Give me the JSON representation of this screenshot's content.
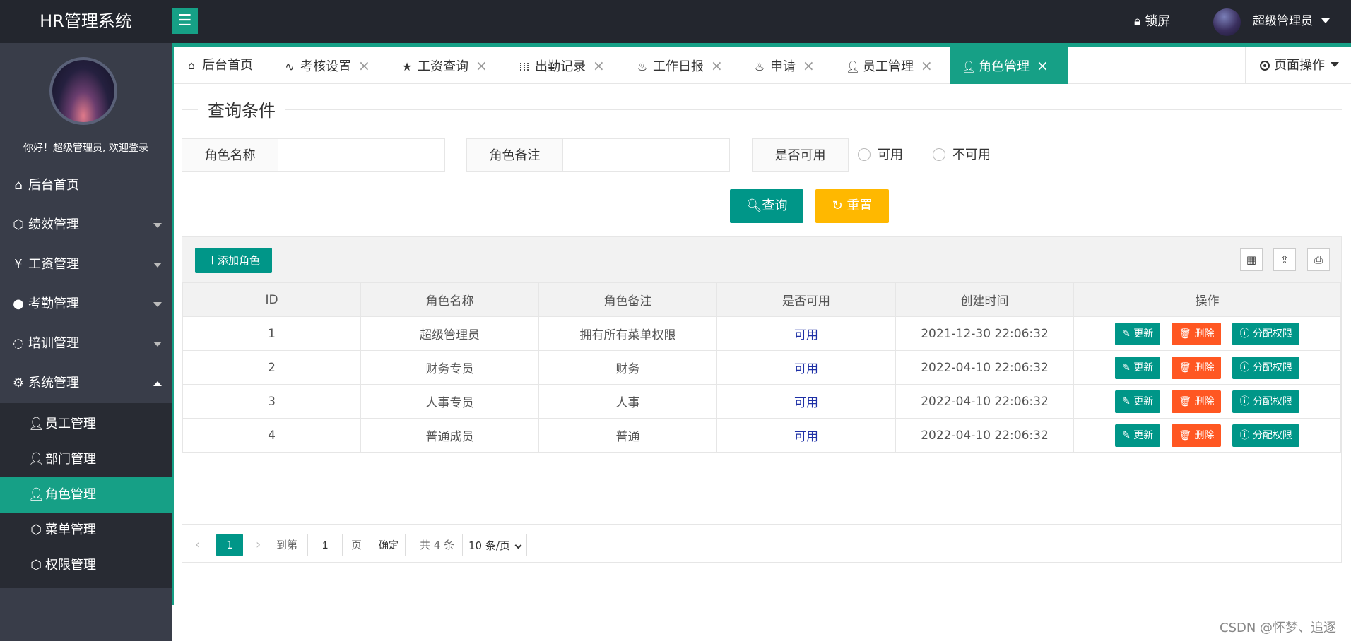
{
  "header": {
    "app_title": "HR管理系统",
    "menu_toggle_icon": "hamburger-icon",
    "lock_label": "锁屏",
    "user_name": "超级管理员"
  },
  "sidebar": {
    "welcome": "你好！超级管理员, 欢迎登录",
    "items": [
      {
        "label": "后台首页",
        "icon": "home-icon"
      },
      {
        "label": "绩效管理",
        "icon": "cube-icon"
      },
      {
        "label": "工资管理",
        "icon": "yen-icon"
      },
      {
        "label": "考勤管理",
        "icon": "chat-icon"
      },
      {
        "label": "培训管理",
        "icon": "loading-icon"
      },
      {
        "label": "系统管理",
        "icon": "gear-icon"
      }
    ],
    "sub_items": [
      {
        "label": "员工管理",
        "icon": "user-icon"
      },
      {
        "label": "部门管理",
        "icon": "user-icon"
      },
      {
        "label": "角色管理",
        "icon": "user-icon",
        "active": true
      },
      {
        "label": "菜单管理",
        "icon": "cube-icon"
      },
      {
        "label": "权限管理",
        "icon": "cube-icon"
      }
    ]
  },
  "tabs": [
    {
      "label": "后台首页",
      "icon": "home-icon"
    },
    {
      "label": "考核设置",
      "icon": "pulse-icon"
    },
    {
      "label": "工资查询",
      "icon": "star-icon"
    },
    {
      "label": "出勤记录",
      "icon": "grid-icon"
    },
    {
      "label": "工作日报",
      "icon": "fire-icon"
    },
    {
      "label": "申请",
      "icon": "fire-icon"
    },
    {
      "label": "员工管理",
      "icon": "user-icon"
    },
    {
      "label": "角色管理",
      "icon": "user-icon",
      "active": true
    }
  ],
  "page_ops_label": "页面操作",
  "query": {
    "legend": "查询条件",
    "role_name_label": "角色名称",
    "role_name_value": "",
    "role_remark_label": "角色备注",
    "role_remark_value": "",
    "enabled_label": "是否可用",
    "option_enabled": "可用",
    "option_disabled": "不可用",
    "search_button": "查询",
    "reset_button": "重置"
  },
  "toolbar": {
    "add_role": "添加角色",
    "tools": [
      "columns-icon",
      "export-icon",
      "print-icon"
    ]
  },
  "table": {
    "columns": [
      "ID",
      "角色名称",
      "角色备注",
      "是否可用",
      "创建时间",
      "操作"
    ],
    "rows": [
      {
        "id": "1",
        "name": "超级管理员",
        "remark": "拥有所有菜单权限",
        "enabled": "可用",
        "created": "2021-12-30 22:06:32"
      },
      {
        "id": "2",
        "name": "财务专员",
        "remark": "财务",
        "enabled": "可用",
        "created": "2022-04-10 22:06:32"
      },
      {
        "id": "3",
        "name": "人事专员",
        "remark": "人事",
        "enabled": "可用",
        "created": "2022-04-10 22:06:32"
      },
      {
        "id": "4",
        "name": "普通成员",
        "remark": "普通",
        "enabled": "可用",
        "created": "2022-04-10 22:06:32"
      }
    ],
    "actions": {
      "update": "更新",
      "delete": "删除",
      "assign": "分配权限"
    }
  },
  "pager": {
    "current_page": "1",
    "goto_label": "到第",
    "goto_value": "1",
    "page_unit": "页",
    "confirm": "确定",
    "total": "共 4 条",
    "page_size": "10 条/页"
  },
  "watermark": "CSDN @怀梦、追逐",
  "colors": {
    "accent": "#16a086",
    "header_bg": "#23262e",
    "sidebar_bg": "#393d49",
    "danger": "#ff5722",
    "warn": "#ffb800"
  }
}
